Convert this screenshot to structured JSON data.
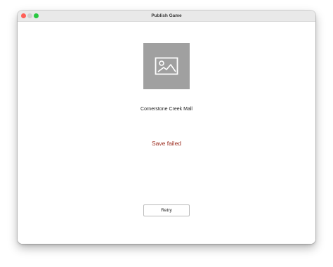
{
  "window": {
    "title": "Publish Game"
  },
  "game": {
    "thumbnail_icon": "image-placeholder-icon",
    "name": "Cornerstone Creek Mall"
  },
  "status": {
    "message": "Save failed",
    "color": "#9a2a1c"
  },
  "actions": {
    "retry_label": "Retry"
  },
  "colors": {
    "close": "#ff5f57",
    "minimize": "#d0d0d0",
    "maximize": "#28c840",
    "thumbnail_bg": "#a0a0a0"
  }
}
